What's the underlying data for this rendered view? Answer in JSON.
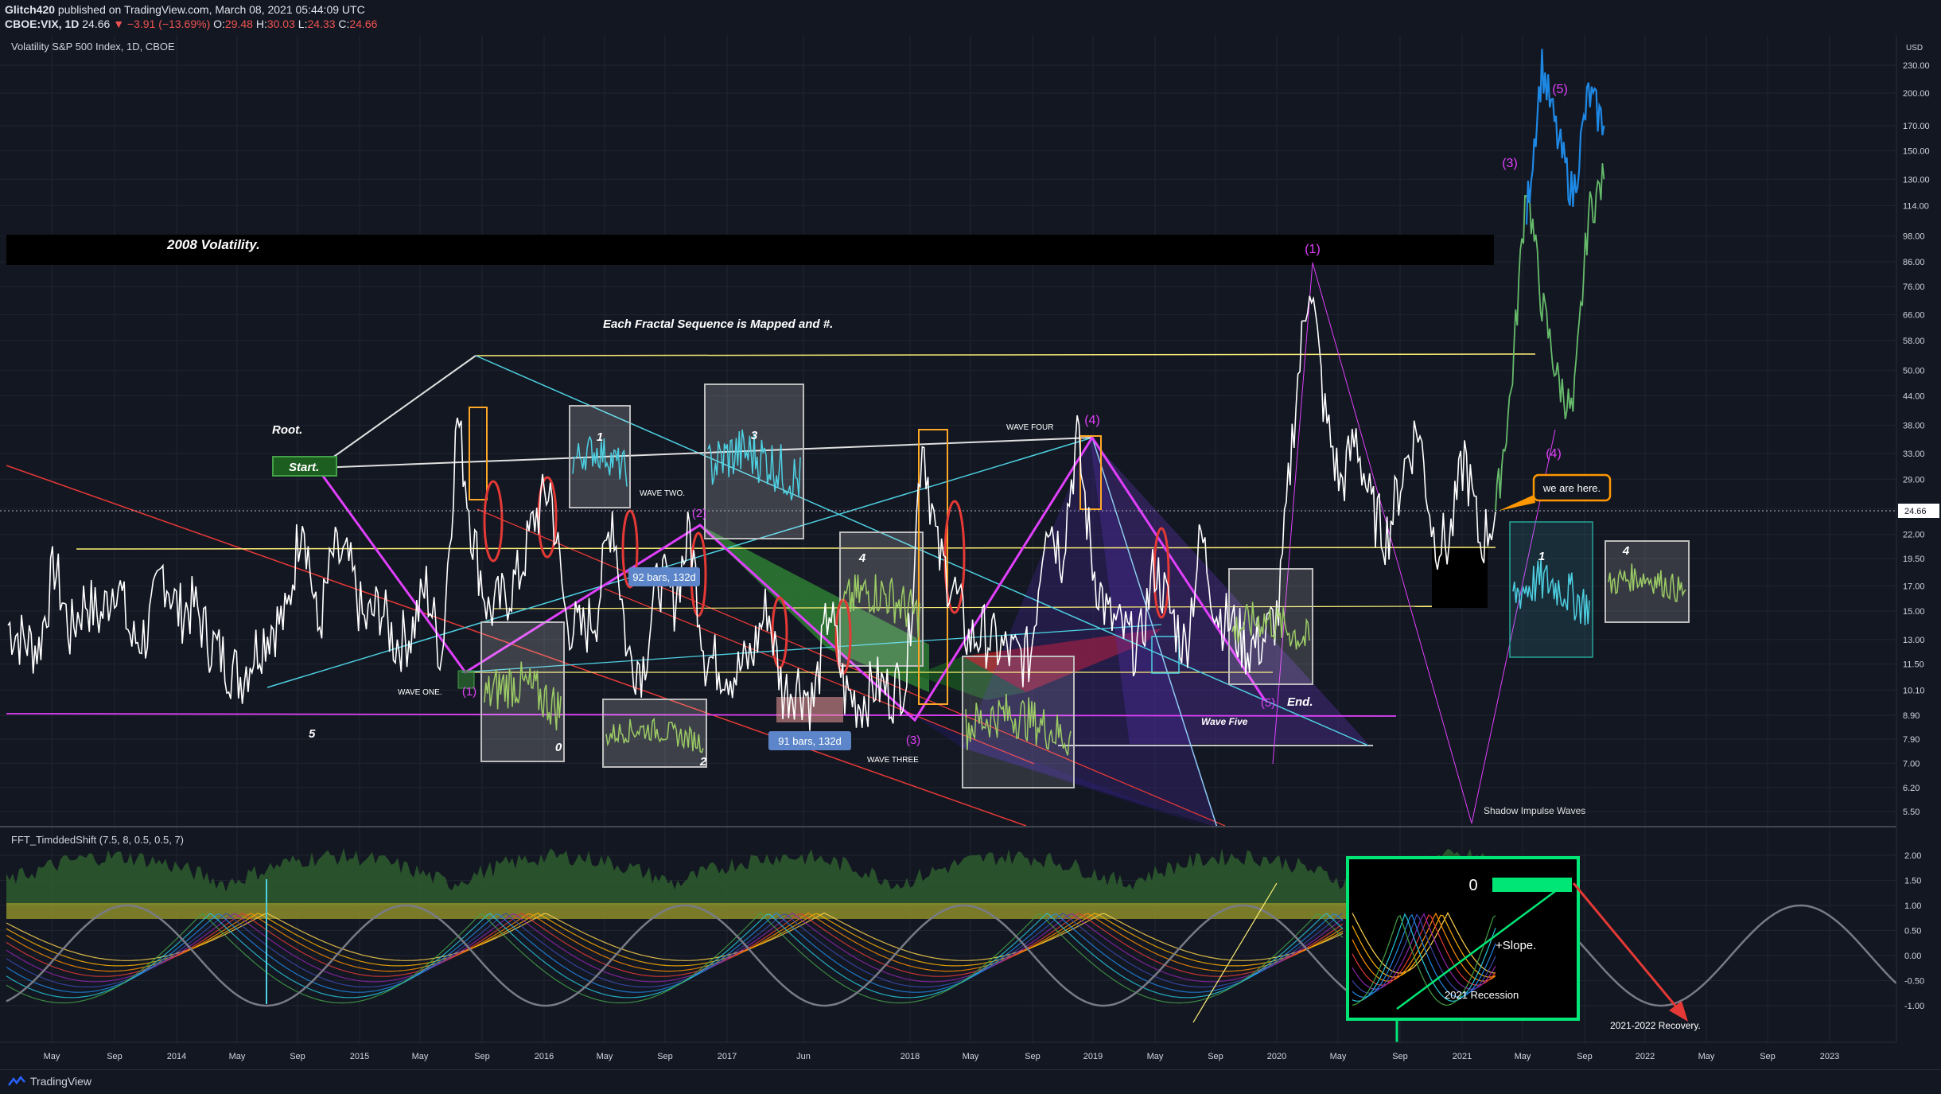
{
  "header": {
    "publisher": "Glitch420",
    "published": "published on TradingView.com, March 08, 2021 05:44:09 UTC",
    "symbol": "CBOE:VIX, 1D",
    "last": "24.66",
    "change": "−3.91 (−13.69%)",
    "open_label": "O:",
    "open": "29.48",
    "high_label": "H:",
    "high": "30.03",
    "low_label": "L:",
    "low": "24.33",
    "close_label": "C:",
    "close": "24.66"
  },
  "footer": {
    "brand": "TradingView"
  },
  "chart_data": [
    {
      "type": "line",
      "title": "Volatility S&P 500 Index, 1D, CBOE",
      "y_axis": {
        "unit": "USD",
        "scale": "log",
        "ticks": [
          "230.00",
          "200.00",
          "170.00",
          "150.00",
          "130.00",
          "114.00",
          "98.00",
          "86.00",
          "76.00",
          "66.00",
          "58.00",
          "50.00",
          "44.00",
          "38.00",
          "33.00",
          "29.00",
          "25.00",
          "22.00",
          "19.50",
          "17.00",
          "15.00",
          "13.00",
          "11.50",
          "10.10",
          "8.90",
          "7.90",
          "7.00",
          "6.20",
          "5.50"
        ]
      },
      "x_axis": {
        "ticks": [
          "May",
          "Sep",
          "2014",
          "May",
          "Sep",
          "2015",
          "May",
          "Sep",
          "2016",
          "May",
          "Sep",
          "2017",
          "Jun",
          "2018",
          "May",
          "Sep",
          "2019",
          "May",
          "Sep",
          "2020",
          "May",
          "Sep",
          "2021",
          "May",
          "Sep",
          "2022",
          "May",
          "Sep",
          "2023"
        ]
      },
      "last_price_label": "24.66",
      "annotations": {
        "band_title": "2008 Volatility.",
        "headline": "Each Fractal Sequence is Mapped and #.",
        "root": "Root.",
        "start": "Start.",
        "end": "End.",
        "here": "we are here.",
        "shadow": "Shadow Impulse Waves",
        "wave_one": "WAVE ONE.",
        "wave_two": "WAVE TWO.",
        "wave_three": "WAVE THREE",
        "wave_four": "WAVE FOUR",
        "wave_five": "Wave Five",
        "bars_a": "92 bars, 132d",
        "bars_b": "91 bars, 132d",
        "box_nums": [
          "1",
          "3",
          "4",
          "0",
          "2",
          "1",
          "4"
        ],
        "wave_labels": [
          "(1)",
          "(2)",
          "(3)",
          "(4)",
          "(5)",
          "(1)",
          "(3)",
          "(5)",
          "(4)"
        ],
        "five": "5"
      },
      "series": [
        {
          "points": [
            [
              "2013-03",
              14.0
            ],
            [
              "2013-04",
              13.0
            ],
            [
              "2013-05",
              12.5
            ],
            [
              "2013-06",
              19.0
            ],
            [
              "2013-07",
              13.5
            ],
            [
              "2013-08",
              16.0
            ],
            [
              "2013-09",
              14.5
            ],
            [
              "2013-10",
              18.0
            ],
            [
              "2013-11",
              12.8
            ],
            [
              "2013-12",
              13.5
            ],
            [
              "2014-01",
              18.5
            ],
            [
              "2014-02",
              15.0
            ],
            [
              "2014-03",
              15.5
            ],
            [
              "2014-04",
              13.0
            ],
            [
              "2014-05",
              11.8
            ],
            [
              "2014-06",
              10.8
            ],
            [
              "2014-07",
              12.5
            ],
            [
              "2014-08",
              14.0
            ],
            [
              "2014-09",
              14.5
            ],
            [
              "2014-10",
              25.5
            ],
            [
              "2014-11",
              13.5
            ],
            [
              "2014-12",
              20.0
            ],
            [
              "2015-01",
              19.0
            ],
            [
              "2015-02",
              14.0
            ],
            [
              "2015-03",
              15.5
            ],
            [
              "2015-04",
              12.8
            ],
            [
              "2015-05",
              13.5
            ],
            [
              "2015-06",
              17.0
            ],
            [
              "2015-07",
              12.0
            ],
            [
              "2015-08",
              40.0
            ],
            [
              "2015-09",
              22.0
            ],
            [
              "2015-10",
              15.0
            ],
            [
              "2015-11",
              16.0
            ],
            [
              "2015-12",
              18.0
            ],
            [
              "2016-01",
              24.0
            ],
            [
              "2016-02",
              28.0
            ],
            [
              "2016-03",
              14.5
            ],
            [
              "2016-04",
              13.5
            ],
            [
              "2016-05",
              15.0
            ],
            [
              "2016-06",
              25.0
            ],
            [
              "2016-07",
              12.0
            ],
            [
              "2016-08",
              11.5
            ],
            [
              "2016-09",
              18.0
            ],
            [
              "2016-10",
              16.0
            ],
            [
              "2016-11",
              22.5
            ],
            [
              "2016-12",
              12.0
            ],
            [
              "2017-01",
              11.5
            ],
            [
              "2017-02",
              11.0
            ],
            [
              "2017-03",
              12.0
            ],
            [
              "2017-04",
              15.5
            ],
            [
              "2017-05",
              10.0
            ],
            [
              "2017-06",
              10.5
            ],
            [
              "2017-07",
              9.5
            ],
            [
              "2017-08",
              15.5
            ],
            [
              "2017-09",
              10.0
            ],
            [
              "2017-10",
              9.5
            ],
            [
              "2017-11",
              10.5
            ],
            [
              "2017-12",
              10.0
            ],
            [
              "2018-01",
              11.0
            ],
            [
              "2018-02",
              37.0
            ],
            [
              "2018-03",
              20.0
            ],
            [
              "2018-04",
              17.0
            ],
            [
              "2018-05",
              13.0
            ],
            [
              "2018-06",
              13.5
            ],
            [
              "2018-07",
              12.5
            ],
            [
              "2018-08",
              12.0
            ],
            [
              "2018-09",
              12.0
            ],
            [
              "2018-10",
              25.0
            ],
            [
              "2018-11",
              20.0
            ],
            [
              "2018-12",
              36.0
            ],
            [
              "2019-01",
              19.0
            ],
            [
              "2019-02",
              14.5
            ],
            [
              "2019-03",
              13.5
            ],
            [
              "2019-04",
              12.5
            ],
            [
              "2019-05",
              19.0
            ],
            [
              "2019-06",
              15.0
            ],
            [
              "2019-07",
              12.5
            ],
            [
              "2019-08",
              22.0
            ],
            [
              "2019-09",
              15.0
            ],
            [
              "2019-10",
              14.0
            ],
            [
              "2019-11",
              12.5
            ],
            [
              "2019-12",
              13.0
            ],
            [
              "2020-01",
              15.0
            ],
            [
              "2020-02",
              40.0
            ],
            [
              "2020-03",
              82.0
            ],
            [
              "2020-04",
              40.0
            ],
            [
              "2020-05",
              28.0
            ],
            [
              "2020-06",
              36.0
            ],
            [
              "2020-07",
              25.0
            ],
            [
              "2020-08",
              22.0
            ],
            [
              "2020-09",
              30.0
            ],
            [
              "2020-10",
              38.0
            ],
            [
              "2020-11",
              22.0
            ],
            [
              "2020-12",
              21.0
            ],
            [
              "2021-01",
              33.0
            ],
            [
              "2021-02",
              21.0
            ],
            [
              "2021-03",
              24.66
            ]
          ]
        },
        {
          "name": "projection",
          "points": [
            [
              "2021-03",
              24.66
            ],
            [
              "2021-04",
              45.0
            ],
            [
              "2021-05",
              130.0
            ],
            [
              "2021-06",
              70.0
            ],
            [
              "2021-07",
              48.0
            ],
            [
              "2021-08",
              40.0
            ],
            [
              "2021-09",
              110.0
            ],
            [
              "2021-10",
              130.0
            ]
          ]
        },
        {
          "name": "projection-blue",
          "points": [
            [
              "2021-05",
              110.0
            ],
            [
              "2021-06",
              230.0
            ],
            [
              "2021-07",
              160.0
            ],
            [
              "2021-08",
              120.0
            ],
            [
              "2021-09",
              200.0
            ],
            [
              "2021-10",
              170.0
            ]
          ]
        }
      ]
    },
    {
      "type": "area",
      "title": "FFT_TimddedShift (7.5, 8, 0.5, 0.5, 7)",
      "y_axis": {
        "ticks": [
          "2.00",
          "1.50",
          "1.00",
          "0.50",
          "0.00",
          "-0.50",
          "-1.00"
        ]
      },
      "annotations": {
        "zero": "0",
        "slope": "+Slope.",
        "recession": "2021 Recession",
        "recovery": "2021-2022 Recovery."
      },
      "sine_period_months": 18,
      "sine_amplitude": 1.0
    }
  ]
}
